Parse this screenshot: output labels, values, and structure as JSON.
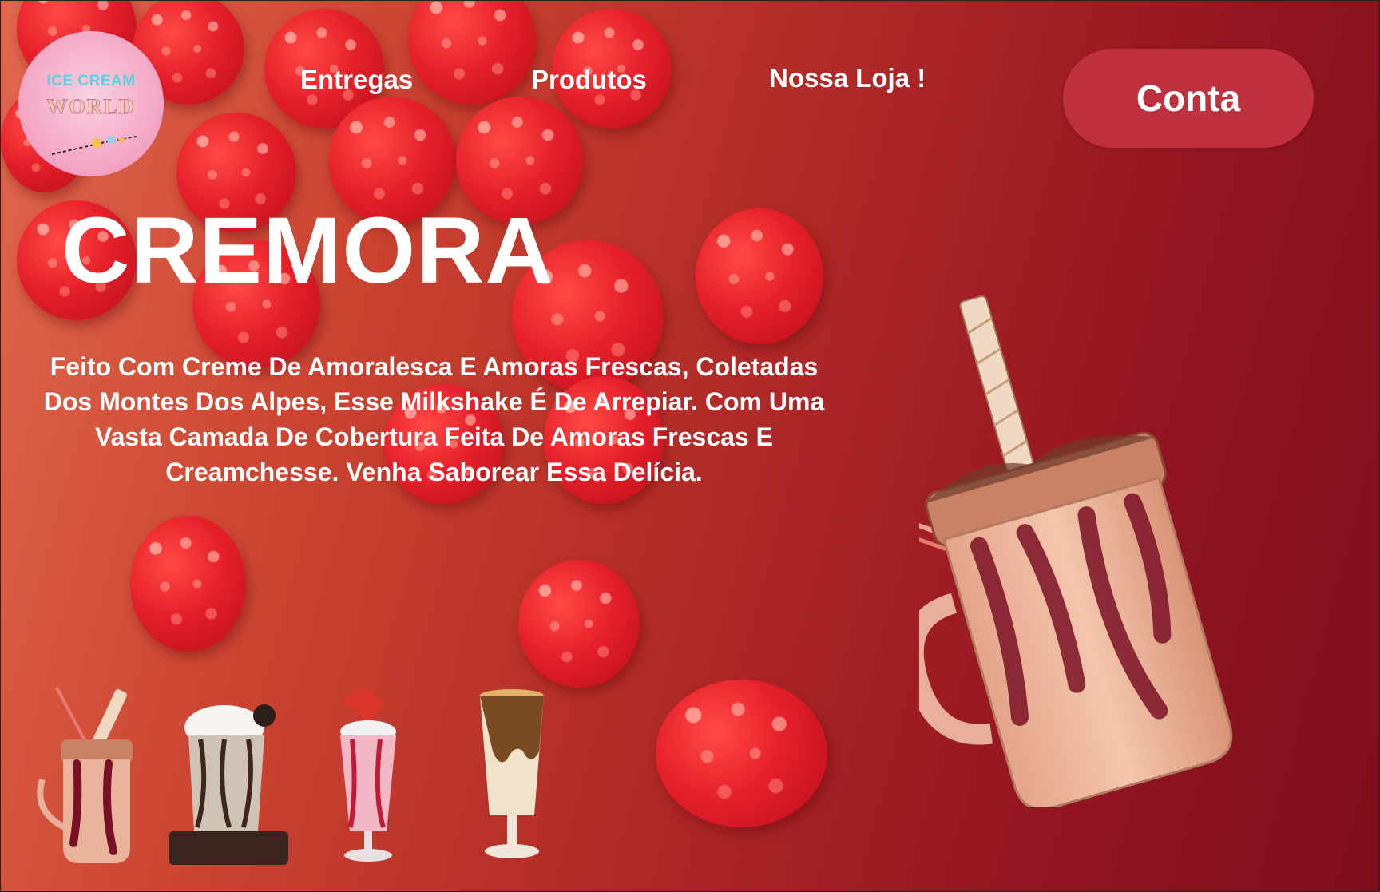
{
  "brand": {
    "logo_line1": "ICE CREAM",
    "logo_line2": "WORLD",
    "colors": {
      "logo_bg": "#f4a9c7",
      "logo_text": "#5ecfe0",
      "accent_button": "#c0313f"
    }
  },
  "nav": {
    "items": [
      {
        "label": "Entregas"
      },
      {
        "label": "Produtos"
      },
      {
        "label": "Nossa Loja !"
      }
    ],
    "account_button": "Conta"
  },
  "hero": {
    "title": "CREMORA",
    "description": "Feito Com Creme De Amoralesca E Amoras Frescas, Coletadas Dos Montes Dos Alpes, Esse Milkshake É De Arrepiar. Com Uma Vasta Camada De Cobertura Feita De Amoras Frescas E Creamchesse. Venha Saborear Essa Delícia."
  },
  "product_thumbnails": [
    {
      "icon": "berry-milkshake-jar-icon"
    },
    {
      "icon": "cookies-milkshake-icon"
    },
    {
      "icon": "strawberry-milkshake-glass-icon"
    },
    {
      "icon": "caramel-milkshake-glass-icon"
    }
  ],
  "featured_product_icon": "berry-milkshake-mason-jar-icon"
}
